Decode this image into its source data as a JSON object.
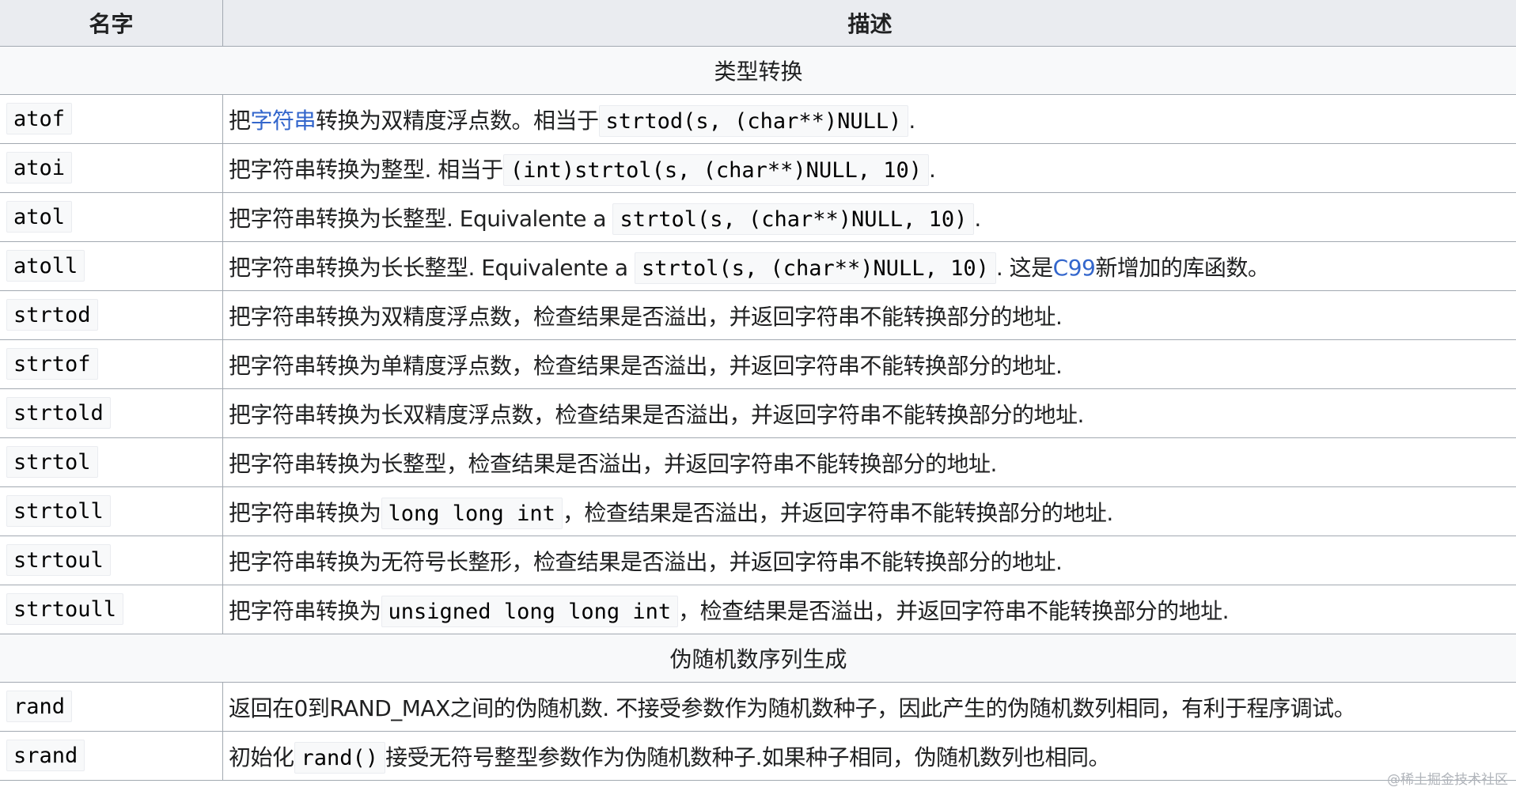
{
  "table": {
    "header": {
      "name": "名字",
      "desc": "描述"
    },
    "section_type_conversion": "类型转换",
    "atof": {
      "name": "atof",
      "d1": "把",
      "link": "字符串",
      "d2": "转换为双精度浮点数。相当于",
      "code": "strtod(s, (char**)NULL)",
      "d3": "."
    },
    "atoi": {
      "name": "atoi",
      "d1": "把字符串转换为整型. 相当于",
      "code": "(int)strtol(s, (char**)NULL, 10)",
      "d2": "."
    },
    "atol": {
      "name": "atol",
      "d1": "把字符串转换为长整型. Equivalente a ",
      "code": "strtol(s, (char**)NULL, 10)",
      "d2": "."
    },
    "atoll": {
      "name": "atoll",
      "d1": "把字符串转换为长长整型. Equivalente a ",
      "code": "strtol(s, (char**)NULL, 10)",
      "d2": ". 这是",
      "link": "C99",
      "d3": "新增加的库函数。"
    },
    "strtod": {
      "name": "strtod",
      "desc": "把字符串转换为双精度浮点数，检查结果是否溢出，并返回字符串不能转换部分的地址."
    },
    "strtof": {
      "name": "strtof",
      "desc": "把字符串转换为单精度浮点数，检查结果是否溢出，并返回字符串不能转换部分的地址."
    },
    "strtold": {
      "name": "strtold",
      "desc": "把字符串转换为长双精度浮点数，检查结果是否溢出，并返回字符串不能转换部分的地址."
    },
    "strtol": {
      "name": "strtol",
      "desc": "把字符串转换为长整型，检查结果是否溢出，并返回字符串不能转换部分的地址."
    },
    "strtoll": {
      "name": "strtoll",
      "d1": "把字符串转换为",
      "code": "long long int",
      "d2": "，检查结果是否溢出，并返回字符串不能转换部分的地址."
    },
    "strtoul": {
      "name": "strtoul",
      "desc": "把字符串转换为无符号长整形，检查结果是否溢出，并返回字符串不能转换部分的地址."
    },
    "strtoull": {
      "name": "strtoull",
      "d1": "把字符串转换为",
      "code": "unsigned long long int",
      "d2": "，检查结果是否溢出，并返回字符串不能转换部分的地址."
    },
    "section_prng": "伪随机数序列生成",
    "rand": {
      "name": "rand",
      "desc": "返回在0到RAND_MAX之间的伪随机数. 不接受参数作为随机数种子，因此产生的伪随机数列相同，有利于程序调试。"
    },
    "srand": {
      "name": "srand",
      "d1": "初始化",
      "code": "rand()",
      "d2": "接受无符号整型参数作为伪随机数种子.如果种子相同，伪随机数列也相同。"
    }
  },
  "watermark": "@稀土掘金技术社区"
}
